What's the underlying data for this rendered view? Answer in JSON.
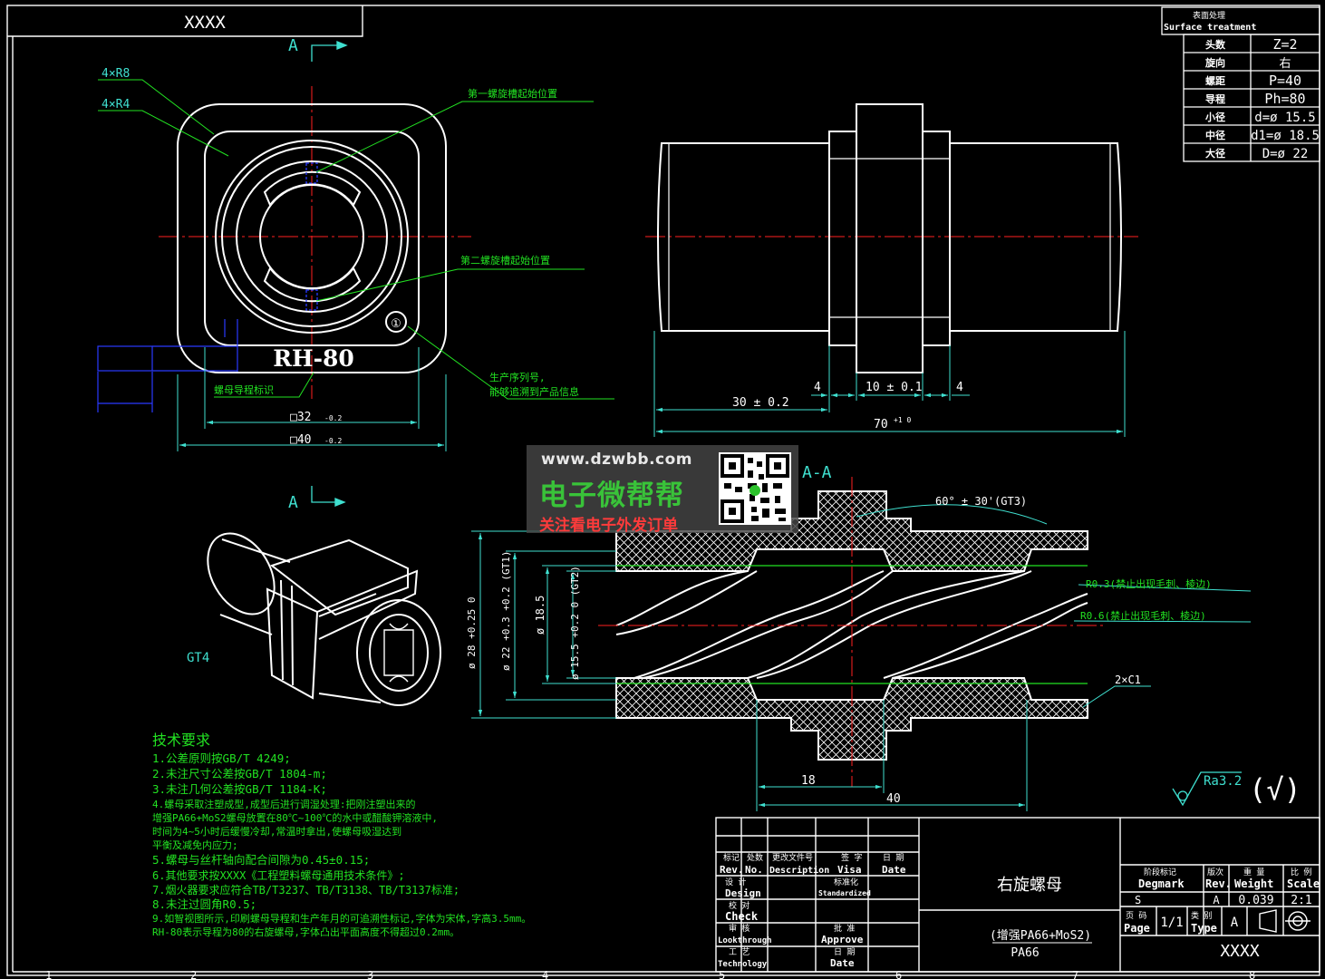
{
  "drawing": {
    "top_box_text": "XXXX",
    "section_marker": "A",
    "section_view_label": "A-A",
    "iso_label": "GT4",
    "corner_labels": [
      "4×R8",
      "4×R4"
    ],
    "marking_text": "RH-80",
    "note_first_groove": "第一螺旋槽起始位置",
    "note_second_groove": "第二螺旋槽起始位置",
    "note_guide_mark": "螺母导程标识",
    "note_serial_1": "生产序列号,",
    "note_serial_2": "能够追溯到产品信息",
    "face_dims": [
      "□32",
      "□40"
    ],
    "face_tol": "-0.2",
    "side_dims": {
      "d4a": "4",
      "d10": "10 ± 0.1",
      "d4b": "4",
      "d30": "30 ± 0.2",
      "d70": "70",
      "d70_tol": "+1 0"
    },
    "section_dims": {
      "angle": "60° ± 30'(GT3)",
      "r03": "R0.3(禁止出现毛刺、棱边)",
      "r06": "R0.6(禁止出现毛刺、棱边)",
      "chamfer": "2×C1",
      "d28": "ø 28 +0.25 0",
      "d22": "ø 22 +0.3 +0.2 (GT1)",
      "d185": "ø 18.5",
      "d155": "ø 15.5 +0.2 0 (GT2)",
      "len18": "18",
      "len40": "40",
      "roughness": "Ra3.2",
      "check": "(√)"
    },
    "param_table": {
      "title_cn": "表面处理",
      "title_en": "Surface treatment",
      "rows": [
        {
          "label": "头数",
          "value": "Z=2"
        },
        {
          "label": "旋向",
          "value": "右"
        },
        {
          "label": "螺距",
          "value": "P=40"
        },
        {
          "label": "导程",
          "value": "Ph=80"
        },
        {
          "label": "小径",
          "value": "d=ø 15.5"
        },
        {
          "label": "中径",
          "value": "d1=ø 18.5"
        },
        {
          "label": "大径",
          "value": "D=ø 22"
        }
      ]
    },
    "tech_title": "技术要求",
    "tech_lines": [
      "1.公差原则按GB/T 4249;",
      "2.未注尺寸公差按GB/T 1804-m;",
      "3.未注几何公差按GB/T 1184-K;",
      "4.螺母采取注塑成型,成型后进行调湿处理:把刚注塑出来的",
      "  增强PA66+MoS2螺母放置在80℃~100℃的水中或醋酸钾溶液中,",
      "  时间为4~5小时后缓慢冷却,常温时拿出,使螺母吸湿达到",
      "  平衡及减免内应力;",
      "5.螺母与丝杆轴向配合间隙为0.45±0.15;",
      "6.其他要求按XXXX《工程塑料螺母通用技术条件》;",
      "7.烟火器要求应符合TB/T3237、TB/T3138、TB/T3137标准;",
      "8.未注过圆角R0.5;",
      "9.如智视图所示,印刷螺母导程和生产年月的可追溯性标记,字体为宋体,字高3.5mm。",
      "  RH-80表示导程为80的右旋螺母,字体凸出平面高度不得超过0.2mm。"
    ],
    "title_block": {
      "headers_cn": [
        "标记",
        "处数",
        "更改文件号",
        "签 字",
        "日 期"
      ],
      "headers_en": [
        "Rev.",
        "No.",
        "Description",
        "Visa",
        "Date"
      ],
      "design_cn": "设 计",
      "design_en": "Design",
      "std_cn": "标准化",
      "std_en": "Standardized",
      "check_cn": "校 对",
      "check_en": "Check",
      "look_cn": "审 核",
      "look_en": "Lookthrough",
      "approve_cn": "批 准",
      "approve_en": "Approve",
      "tech_cn": "工 艺",
      "tech_en": "Technology",
      "date_cn": "日 期",
      "date_en": "Date",
      "part_name": "右旋螺母",
      "material_1": "(增强PA66+MoS2)",
      "material_2": "PA66",
      "mark_cn": "阶段标记",
      "mark_en": "Degmark",
      "rev_cn": "版次",
      "rev_en": "Rev.",
      "weight_cn": "重 量",
      "weight_en": "Weight",
      "scale_cn": "比 例",
      "scale_en": "Scale",
      "s_value": "S",
      "rev_value": "A",
      "weight_value": "0.039",
      "scale_value": "2:1",
      "page_cn": "页 码",
      "page_en": "Page",
      "page_value": "1/1",
      "type_cn": "类 别",
      "type_en": "Type",
      "type_value": "A",
      "drawing_no": "XXXX"
    },
    "zone_numbers": [
      "1",
      "2",
      "3",
      "4",
      "5",
      "6",
      "7",
      "8"
    ]
  },
  "watermark": {
    "url": "www.dzwbb.com",
    "title": "电子微帮帮",
    "subtitle": "关注看电子外发订单"
  },
  "colors": {
    "background": "#000000",
    "line": "#ffffff",
    "center": "#ff2020",
    "dimension": "#3fe0d0",
    "note": "#22e222",
    "hidden": "#2a3aff"
  }
}
